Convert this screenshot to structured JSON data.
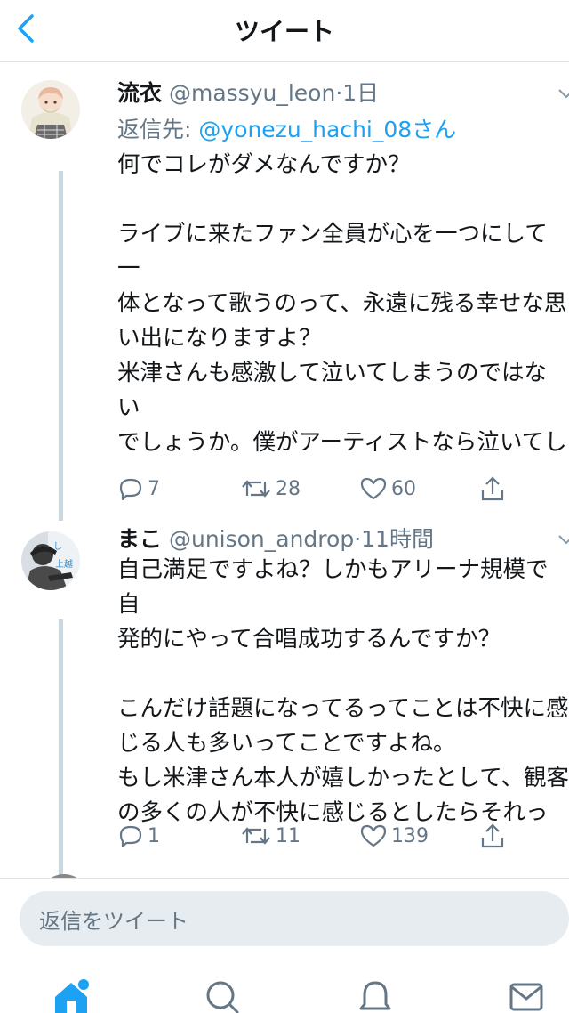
{
  "header": {
    "title": "ツイート"
  },
  "tweets": [
    {
      "name": "流衣",
      "handle": "@massyu_leon",
      "dot": "·",
      "time": "1日",
      "reply_prefix": "返信先: ",
      "reply_to": "@yonezu_hachi_08さん",
      "body": "何でコレがダメなんですか？\n\nライブに来たファン全員が心を一つにして一\n体となって歌うのって、永遠に残る幸せな思\nい出になりますよ？\n米津さんも感激して泣いてしまうのではない\nでしょうか。僕がアーティストなら泣いてし\nまいます。。\n秦基博さんや大森靖子さんのライブでも全員\nで合唱しましたよ。",
      "replies": "7",
      "retweets": "28",
      "likes": "60"
    },
    {
      "name": "まこ",
      "handle": "@unison_androp",
      "dot": "·",
      "time": "11時間",
      "body": "自己満足ですよね？しかもアリーナ規模で自\n発的にやって合唱成功するんですか？\n\nこんだけ話題になってるってことは不快に感\nじる人も多いってことですよね。\nもし米津さん本人が嬉しかったとして、観客\nの多くの人が不快に感じるとしたらそれって\n良いことなんですか？",
      "replies": "1",
      "retweets": "11",
      "likes": "139"
    }
  ],
  "reply_bar": {
    "placeholder": "返信をツイート"
  },
  "colors": {
    "accent": "#1da1f2",
    "secondary_text": "#657786",
    "divider": "#dfe3e6",
    "thread_line": "#ccd6dd"
  },
  "tabbar": {
    "icons": [
      "home-icon",
      "search-icon",
      "notifications-icon",
      "messages-icon"
    ]
  }
}
